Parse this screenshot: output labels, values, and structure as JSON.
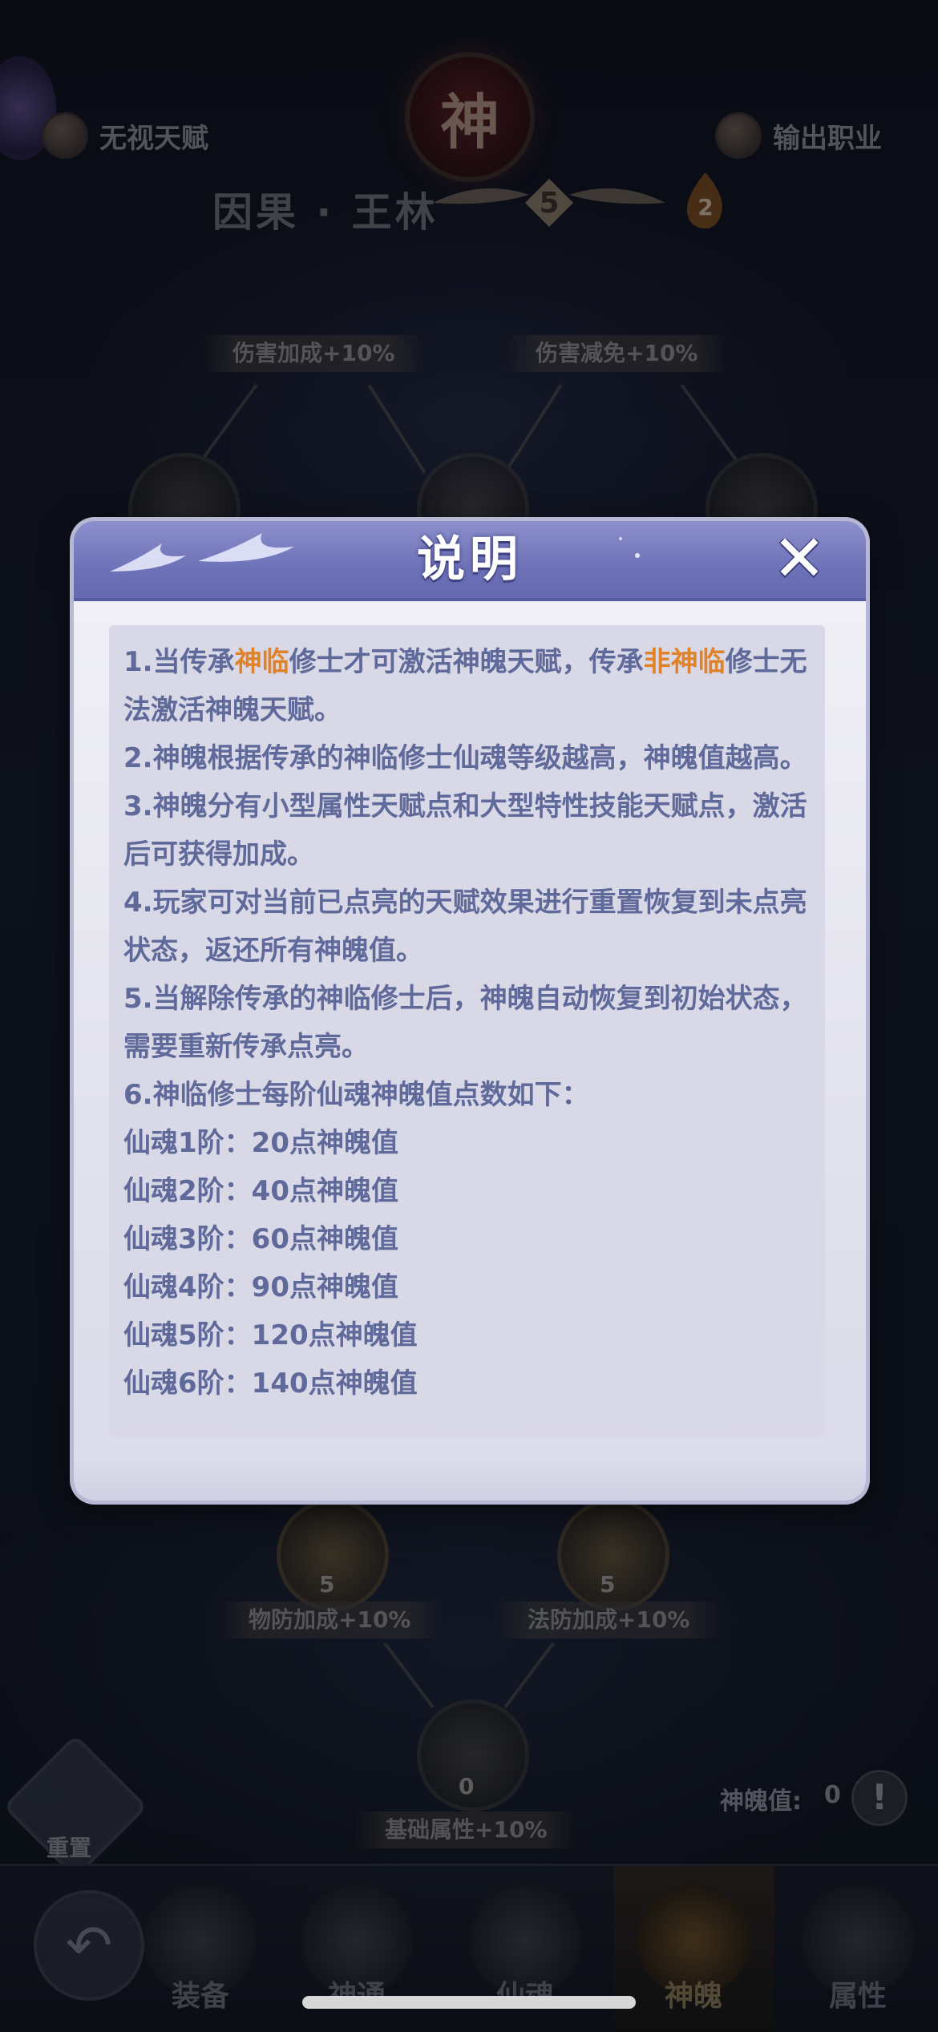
{
  "header": {
    "left_chip_label": "无视天赋",
    "right_chip_label": "输出职业",
    "emblem_char": "神",
    "character_name": "因果 · 王林",
    "star_level": "5",
    "flame_count": "2"
  },
  "talent_tree": {
    "top_labels": [
      "伤害加成+10%",
      "伤害减免+10%"
    ],
    "mid_nodes": [
      {
        "value": "5",
        "label": "物防加成+10%"
      },
      {
        "value": "5",
        "label": "法防加成+10%"
      }
    ],
    "base_node": {
      "value": "0",
      "label": "基础属性+10%"
    },
    "points_label": "神魄值:",
    "points_value": "0",
    "reset_label": "重置"
  },
  "bottom_nav": {
    "tabs": [
      {
        "label": "装备"
      },
      {
        "label": "神通"
      },
      {
        "label": "仙魂"
      },
      {
        "label": "神魄"
      },
      {
        "label": "属性"
      }
    ],
    "active_index": 3
  },
  "modal": {
    "title": "说明",
    "close_icon": "close-icon",
    "p1_a": "1.当传承",
    "p1_hl1": "神临",
    "p1_b": "修士才可激活神魄天赋，传承",
    "p1_hl2": "非神临",
    "p1_c": "修士无法激活神魄天赋。",
    "p2": "2.神魄根据传承的神临修士仙魂等级越高，神魄值越高。",
    "p3": "3.神魄分有小型属性天赋点和大型特性技能天赋点，激活后可获得加成。",
    "p4": "4.玩家可对当前已点亮的天赋效果进行重置恢复到未点亮状态，返还所有神魄值。",
    "p5": "5.当解除传承的神临修士后，神魄自动恢复到初始状态，需要重新传承点亮。",
    "p6": "6.神临修士每阶仙魂神魄值点数如下：",
    "tiers": [
      "仙魂1阶：20点神魄值",
      "仙魂2阶：40点神魄值",
      "仙魂3阶：60点神魄值",
      "仙魂4阶：90点神魄值",
      "仙魂5阶：120点神魄值",
      "仙魂6阶：140点神魄值"
    ],
    "highlight_color": "#e0822a",
    "text_color": "#5f6a9b",
    "header_color": "#6e72b8"
  }
}
